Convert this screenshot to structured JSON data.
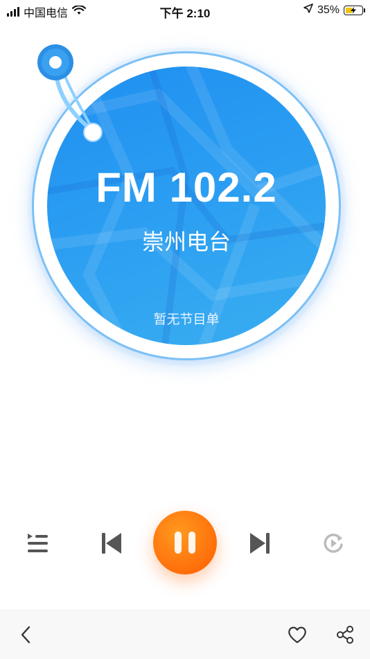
{
  "status_bar": {
    "carrier": "中国电信",
    "time": "下午 2:10",
    "battery": "35%"
  },
  "radio": {
    "frequency": "FM 102.2",
    "station": "崇州电台",
    "program": "暂无节目单"
  },
  "colors": {
    "disc_blue": "#2a9df2",
    "disc_ring": "#7cc0f5",
    "play_orange": "#ff6e0a",
    "icon_gray": "#555555",
    "icon_disabled": "#bbbbbb"
  },
  "controls": {
    "icons": [
      "playlist-icon",
      "previous-icon",
      "pause-icon",
      "next-icon",
      "replay-icon"
    ]
  },
  "bottom_bar": {
    "icons": [
      "back-icon",
      "heart-icon",
      "share-icon"
    ]
  }
}
